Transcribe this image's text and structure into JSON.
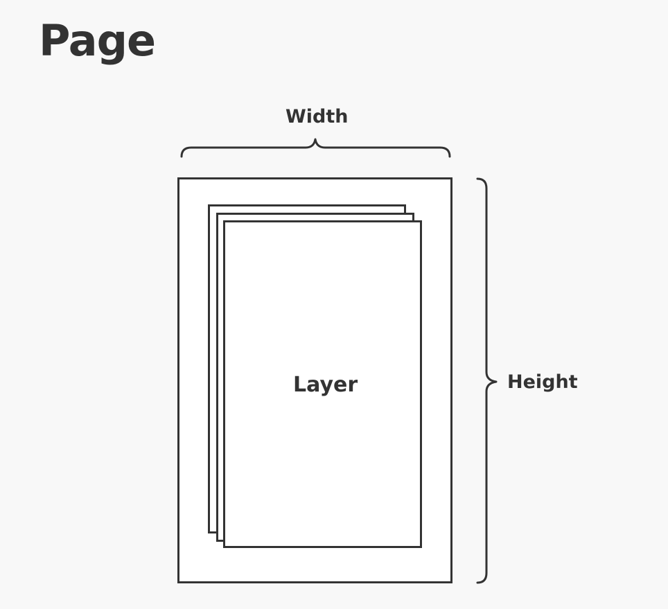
{
  "title": "Page",
  "diagram": {
    "width_label": "Width",
    "height_label": "Height",
    "layer_label": "Layer",
    "layer_count": 3,
    "line_color": "#333333",
    "fill_color": "#ffffff",
    "background_color": "#f8f8f8"
  }
}
